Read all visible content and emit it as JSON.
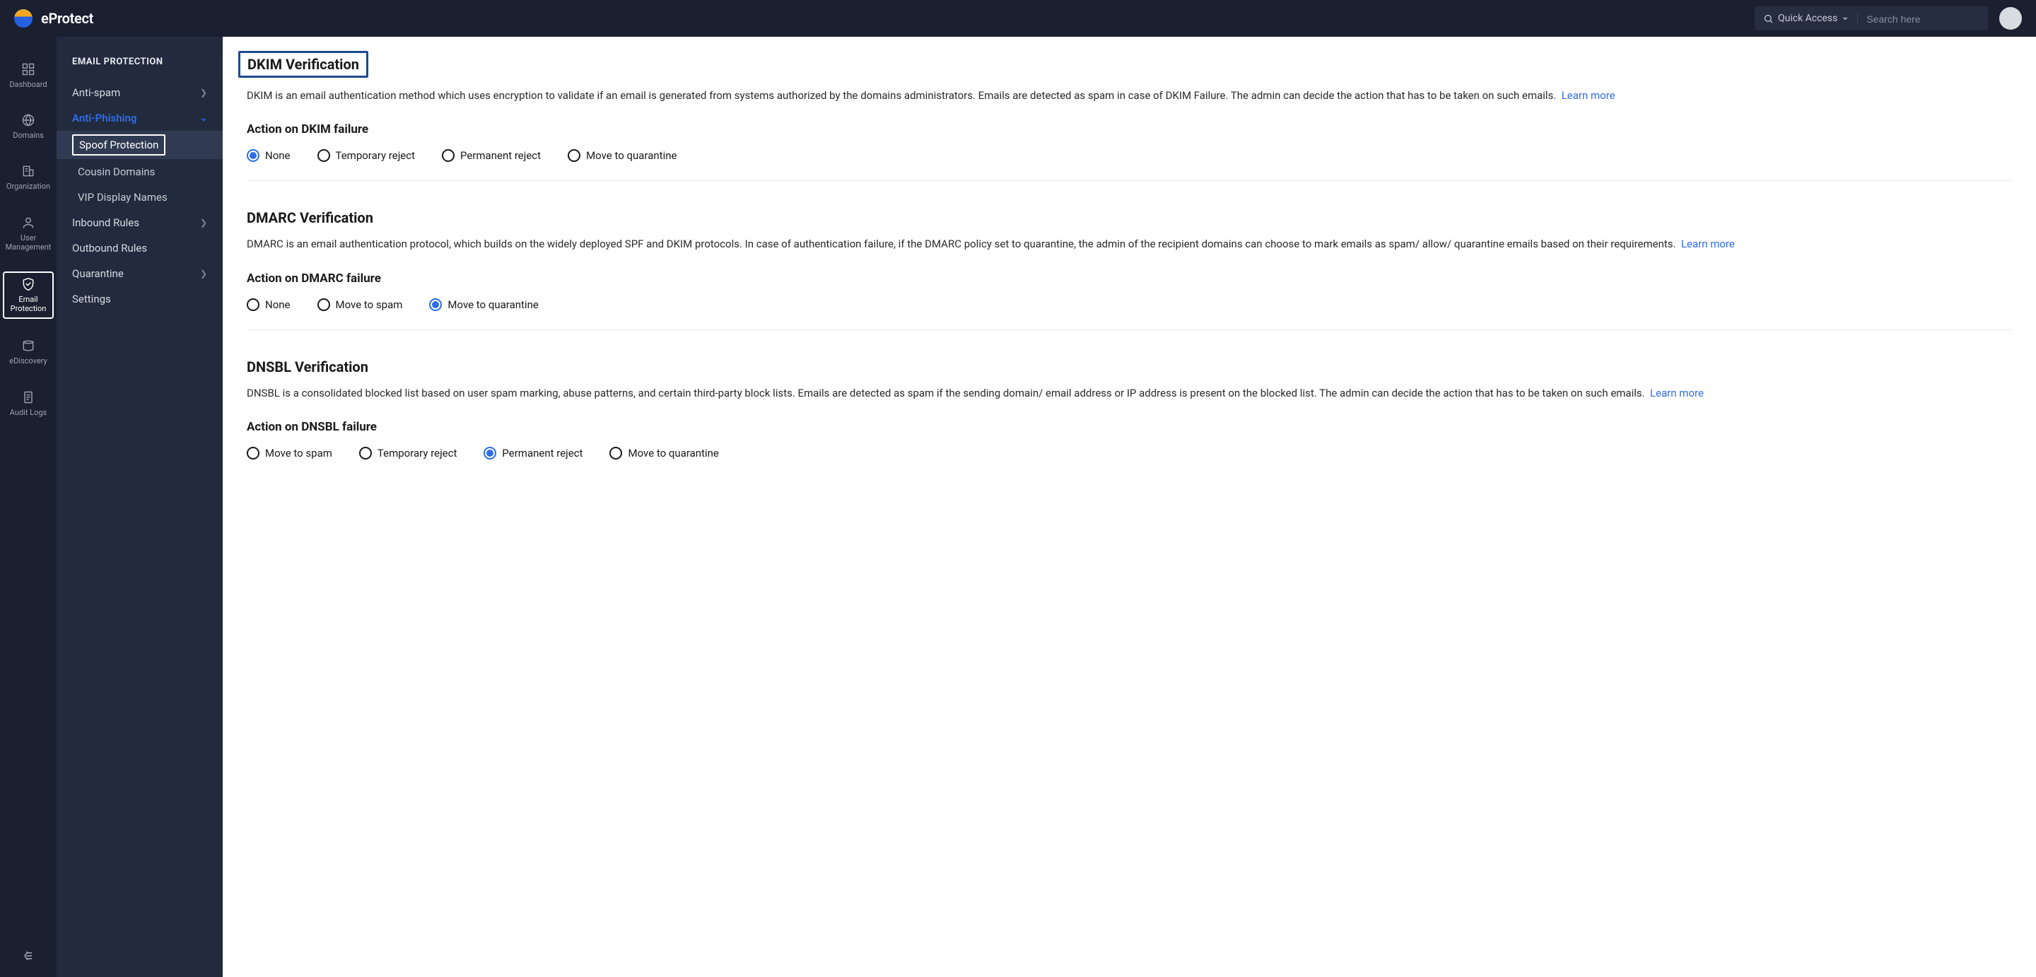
{
  "brand": {
    "name": "eProtect"
  },
  "header": {
    "quick_access_label": "Quick Access",
    "search_placeholder": "Search here"
  },
  "rail": {
    "items": [
      {
        "label": "Dashboard",
        "icon": "grid"
      },
      {
        "label": "Domains",
        "icon": "globe"
      },
      {
        "label": "Organization",
        "icon": "building"
      },
      {
        "label": "User Management",
        "icon": "user"
      },
      {
        "label": "Email Protection",
        "icon": "shield",
        "active": true
      },
      {
        "label": "eDiscovery",
        "icon": "archive"
      },
      {
        "label": "Audit Logs",
        "icon": "file"
      }
    ]
  },
  "secondary_nav": {
    "title": "EMAIL PROTECTION",
    "items": [
      {
        "label": "Anti-spam",
        "expandable": true
      },
      {
        "label": "Anti-Phishing",
        "expandable": true,
        "expanded": true,
        "children": [
          {
            "label": "Spoof Protection",
            "active": true
          },
          {
            "label": "Cousin Domains"
          },
          {
            "label": "VIP Display Names"
          }
        ]
      },
      {
        "label": "Inbound Rules",
        "expandable": true
      },
      {
        "label": "Outbound Rules"
      },
      {
        "label": "Quarantine",
        "expandable": true
      },
      {
        "label": "Settings"
      }
    ]
  },
  "sections": {
    "dkim": {
      "title": "DKIM Verification",
      "description": "DKIM is an email authentication method which uses encryption to validate if an email is generated from systems authorized by the domains administrators. Emails are detected as spam in case of DKIM Failure. The admin can decide the action that has to be taken on such emails.",
      "learn_more": "Learn more",
      "action_label": "Action on DKIM failure",
      "options": [
        "None",
        "Temporary reject",
        "Permanent reject",
        "Move to quarantine"
      ],
      "selected": "None"
    },
    "dmarc": {
      "title": "DMARC Verification",
      "description": "DMARC is an email authentication protocol, which builds on the widely deployed SPF and DKIM protocols. In case of authentication failure, if the DMARC policy set to quarantine, the admin of the recipient domains can choose to mark emails as spam/ allow/ quarantine emails based on their requirements.",
      "learn_more": "Learn more",
      "action_label": "Action on DMARC failure",
      "options": [
        "None",
        "Move to spam",
        "Move to quarantine"
      ],
      "selected": "Move to quarantine"
    },
    "dnsbl": {
      "title": "DNSBL Verification",
      "description": "DNSBL is a consolidated blocked list based on user spam marking, abuse patterns, and certain third-party block lists. Emails are detected as spam if the sending domain/ email address or IP address is present on the blocked list. The admin can decide the action that has to be taken on such emails.",
      "learn_more": "Learn more",
      "action_label": "Action on DNSBL failure",
      "options": [
        "Move to spam",
        "Temporary reject",
        "Permanent reject",
        "Move to quarantine"
      ],
      "selected": "Permanent reject"
    }
  }
}
